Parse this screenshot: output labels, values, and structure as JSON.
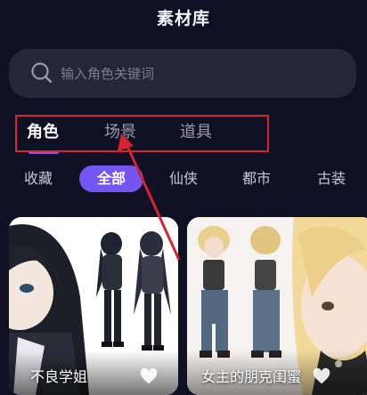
{
  "header": {
    "title": "素材库"
  },
  "search": {
    "placeholder": "输入角色关键词",
    "value": ""
  },
  "tabs": [
    {
      "label": "角色",
      "active": true
    },
    {
      "label": "场景",
      "active": false
    },
    {
      "label": "道具",
      "active": false
    }
  ],
  "chips": [
    {
      "label": "收藏",
      "active": false
    },
    {
      "label": "全部",
      "active": true
    },
    {
      "label": "仙侠",
      "active": false
    },
    {
      "label": "都市",
      "active": false
    },
    {
      "label": "古装",
      "active": false
    }
  ],
  "cards": [
    {
      "label": "不良学姐",
      "favorite": false
    },
    {
      "label": "女主的朋克闺蜜",
      "favorite": false
    }
  ],
  "colors": {
    "background": "#101025",
    "accent": "#7554f4",
    "annotation": "#d8232f",
    "search_bg": "#26263a"
  },
  "icons": {
    "search": "search-icon",
    "favorite": "heart-icon"
  }
}
